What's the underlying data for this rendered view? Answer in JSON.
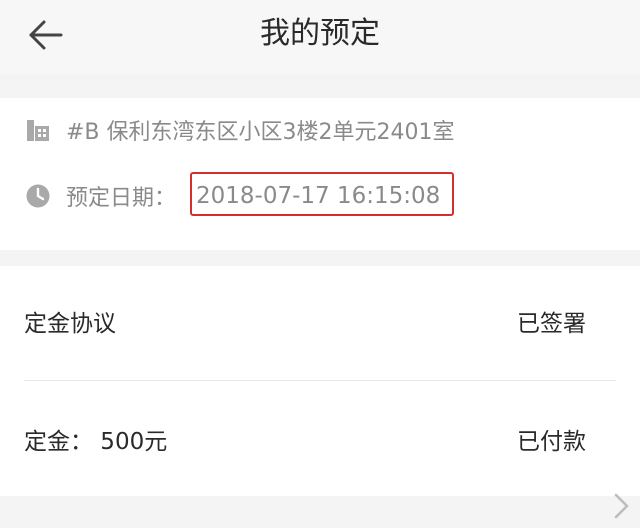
{
  "header": {
    "title": "我的预定",
    "back_icon": "arrow-left-icon"
  },
  "booking": {
    "address": "#B 保利东湾东区小区3楼2单元2401室",
    "address_icon": "building-icon",
    "date_label": "预定日期：",
    "date_value": "2018-07-17 16:15:08",
    "date_icon": "clock-icon"
  },
  "details": [
    {
      "label": "定金协议",
      "status": "已签署"
    },
    {
      "label": "定金：  500元",
      "status": "已付款"
    }
  ],
  "colors": {
    "highlight_border": "#d32f2f",
    "muted_text": "#8a8a8a",
    "page_bg": "#f4f4f4"
  }
}
